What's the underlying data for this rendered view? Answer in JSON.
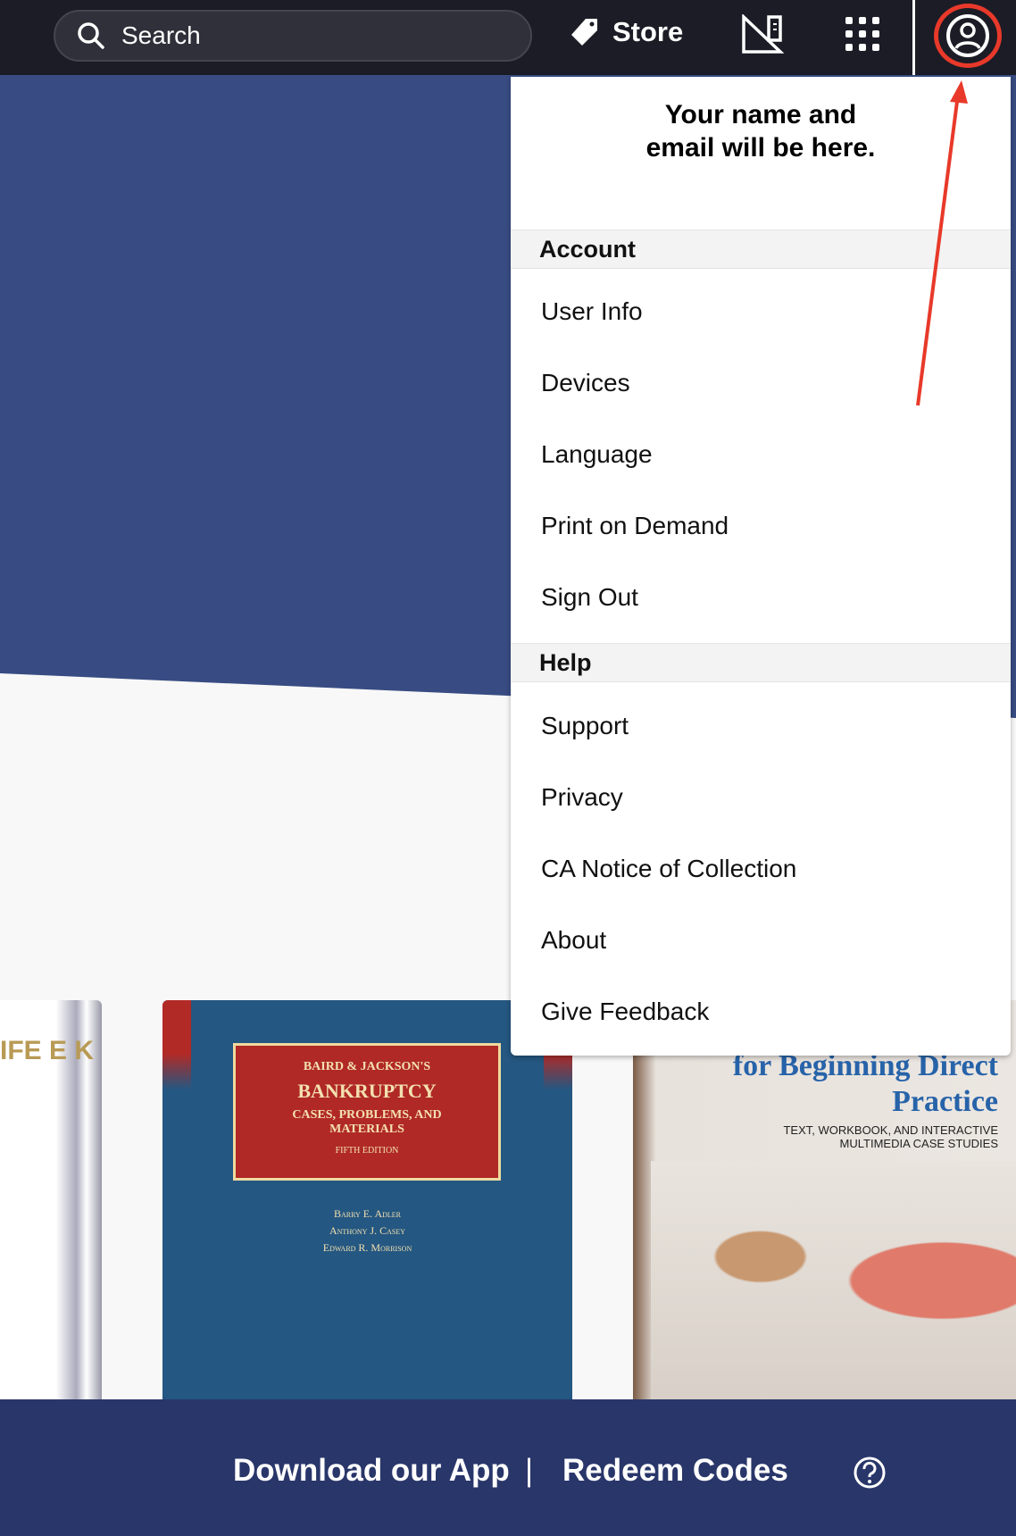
{
  "topbar": {
    "search_placeholder": "Search",
    "store_label": "Store"
  },
  "menu": {
    "header": "Your name and email will be here.",
    "sections": [
      {
        "title": "Account",
        "items": [
          "User Info",
          "Devices",
          "Language",
          "Print on Demand",
          "Sign Out"
        ]
      },
      {
        "title": "Help",
        "items": [
          "Support",
          "Privacy",
          "CA Notice of Collection",
          "About",
          "Give Feedback"
        ]
      }
    ]
  },
  "books": [
    {
      "cover_text": "IFE E K"
    },
    {
      "series": "BAIRD & JACKSON'S",
      "title": "BANKRUPTCY",
      "subtitle": "CASES, PROBLEMS, AND MATERIALS",
      "edition": "FIFTH EDITION",
      "authors": [
        "Barry E. Adler",
        "Anthony J. Casey",
        "Edward R. Morrison"
      ]
    },
    {
      "title": "Social Work Skills for Beginning Direct Practice",
      "subtitle": "TEXT, WORKBOOK, AND INTERACTIVE MULTIMEDIA CASE STUDIES"
    }
  ],
  "footer": {
    "download": "Download our App",
    "separator": "|",
    "redeem": "Redeem Codes"
  },
  "colors": {
    "topbar": "#1b1c25",
    "hero": "#384c83",
    "footer": "#29366a",
    "annotation": "#e8392a"
  }
}
